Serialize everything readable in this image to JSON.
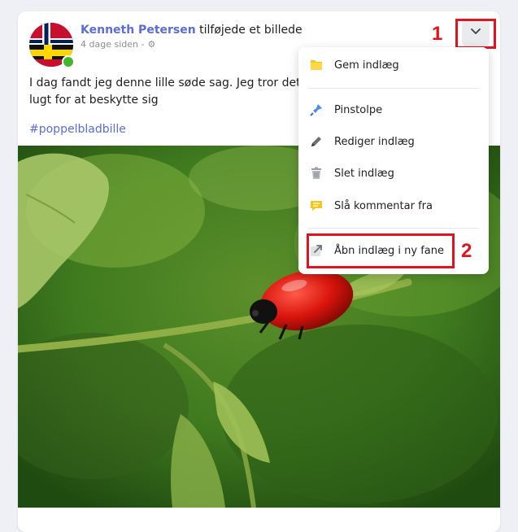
{
  "post": {
    "author": "Kenneth Petersen",
    "action": "tilføjede et billede",
    "time": "4 dage siden -",
    "privacy_icon": "gear-icon",
    "text": "I dag fandt jeg denne lille søde sag. Jeg tror det e dem udskiller den en grim lugt for at beskytte sig",
    "hashtag": "#poppelbladbille"
  },
  "menu": {
    "items": [
      {
        "label": "Gem indlæg",
        "icon": "folder-icon"
      },
      {
        "label": "Pinstolpe",
        "icon": "pin-icon"
      },
      {
        "label": "Rediger indlæg",
        "icon": "pencil-icon"
      },
      {
        "label": "Slet indlæg",
        "icon": "trash-icon"
      },
      {
        "label": "Slå kommentar fra",
        "icon": "comment-icon"
      },
      {
        "label": "Åbn indlæg i ny fane",
        "icon": "external-link-icon"
      }
    ]
  },
  "annotations": {
    "marker1": "1",
    "marker2": "2"
  },
  "colors": {
    "link": "#5a6cd8",
    "annotation": "#e0141e",
    "online": "#42b72a"
  }
}
